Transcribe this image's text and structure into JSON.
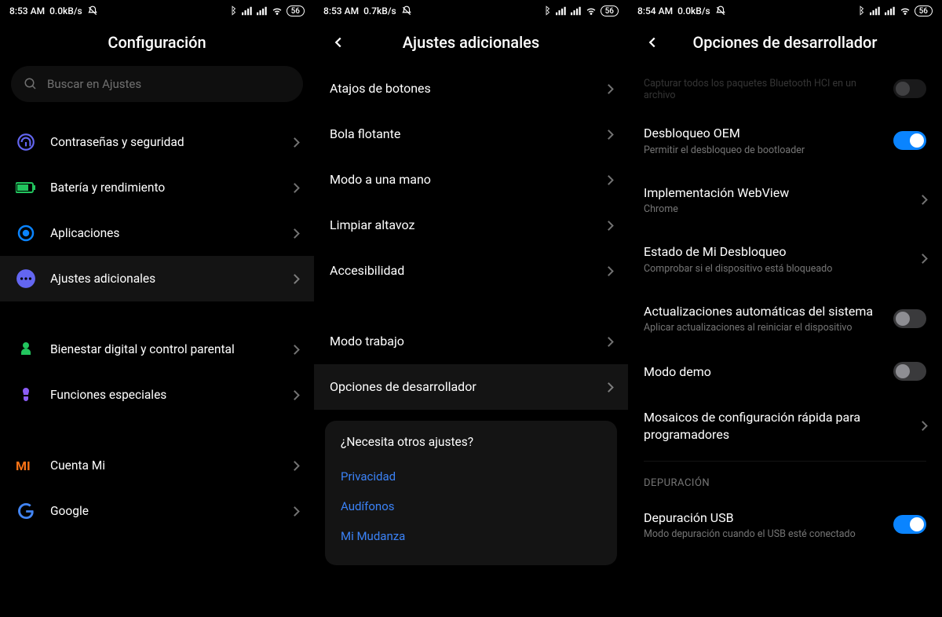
{
  "panel1": {
    "status": {
      "time": "8:53 AM",
      "speed": "0.0kB/s",
      "battery": "56"
    },
    "title": "Configuración",
    "search_placeholder": "Buscar en Ajustes",
    "items": [
      {
        "icon": "fingerprint",
        "color": "#6366f1",
        "label": "Contraseñas y seguridad"
      },
      {
        "icon": "battery",
        "color": "#22c55e",
        "label": "Batería y rendimiento"
      },
      {
        "icon": "apps",
        "color": "#0a84ff",
        "label": "Aplicaciones"
      },
      {
        "icon": "dots",
        "color": "#6366f1",
        "label": "Ajustes adicionales",
        "selected": true
      },
      {
        "spacer": true
      },
      {
        "icon": "wellbeing",
        "color": "#22c55e",
        "label": "Bienestar digital y control parental"
      },
      {
        "icon": "special",
        "color": "#8b5cf6",
        "label": "Funciones especiales"
      },
      {
        "spacer": true
      },
      {
        "icon": "mi",
        "color": "#f97316",
        "label": "Cuenta Mi"
      },
      {
        "icon": "google",
        "color": "",
        "label": "Google"
      }
    ]
  },
  "panel2": {
    "status": {
      "time": "8:53 AM",
      "speed": "0.7kB/s",
      "battery": "56"
    },
    "title": "Ajustes adicionales",
    "items": [
      {
        "label": "Atajos de botones"
      },
      {
        "label": "Bola flotante"
      },
      {
        "label": "Modo a una mano"
      },
      {
        "label": "Limpiar altavoz"
      },
      {
        "label": "Accesibilidad"
      },
      {
        "spacer": true
      },
      {
        "label": "Modo trabajo"
      },
      {
        "label": "Opciones de desarrollador",
        "selected": true
      }
    ],
    "card": {
      "title": "¿Necesita otros ajustes?",
      "links": [
        "Privacidad",
        "Audífonos",
        "Mi Mudanza"
      ]
    }
  },
  "panel3": {
    "status": {
      "time": "8:54 AM",
      "speed": "0.0kB/s",
      "battery": "56"
    },
    "title": "Opciones de desarrollador",
    "top_dim": {
      "label": "Capturar todos los paquetes Bluetooth HCI en un archivo"
    },
    "items": [
      {
        "label": "Desbloqueo OEM",
        "sub": "Permitir el desbloqueo de bootloader",
        "toggle": "on"
      },
      {
        "label": "Implementación WebView",
        "sub": "Chrome",
        "chevron": true
      },
      {
        "label": "Estado de Mi Desbloqueo",
        "sub": "Comprobar si el dispositivo está bloqueado",
        "chevron": true
      },
      {
        "label": "Actualizaciones automáticas del sistema",
        "sub": "Aplicar actualizaciones al reiniciar el dispositivo",
        "toggle": "off"
      },
      {
        "label": "Modo demo",
        "toggle": "off"
      },
      {
        "label": "Mosaicos de configuración rápida para programadores",
        "chevron": true
      }
    ],
    "section_label": "DEPURACIÓN",
    "usb": {
      "label": "Depuración USB",
      "sub": "Modo depuración cuando el USB esté conectado",
      "toggle": "on"
    }
  }
}
